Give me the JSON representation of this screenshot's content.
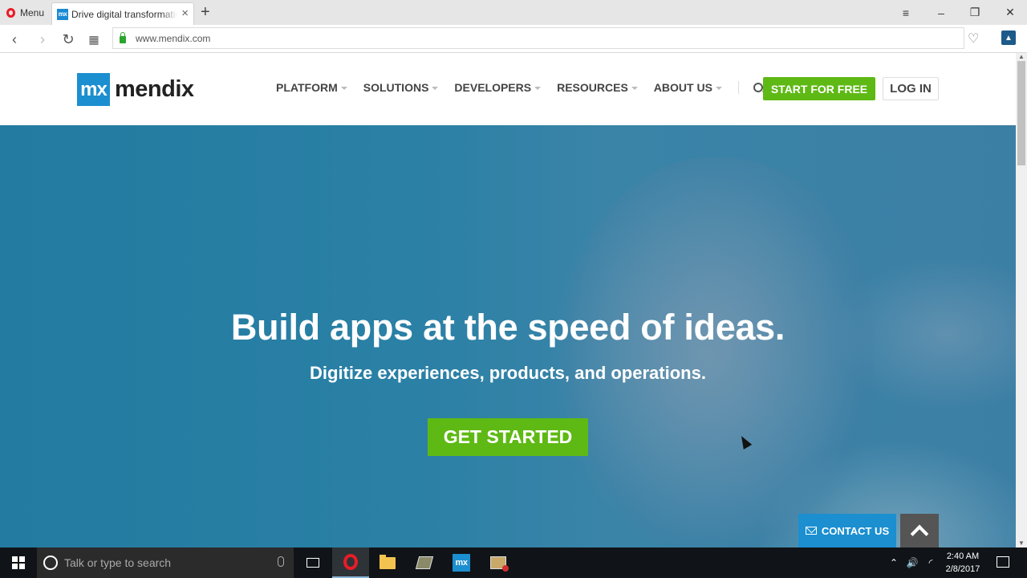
{
  "browser": {
    "menu_label": "Menu",
    "tab_title": "Drive digital transformation",
    "tab_favicon": "mx",
    "url": "www.mendix.com"
  },
  "site": {
    "logo_mark": "mx",
    "logo_text": "mendix",
    "nav": [
      {
        "label": "PLATFORM"
      },
      {
        "label": "SOLUTIONS"
      },
      {
        "label": "DEVELOPERS"
      },
      {
        "label": "RESOURCES"
      },
      {
        "label": "ABOUT US"
      }
    ],
    "start_button": "START FOR FREE",
    "login_button": "LOG IN",
    "accent_color": "#5eb914",
    "brand_color": "#1b8fd0"
  },
  "hero": {
    "title": "Build apps at the speed of ideas.",
    "subtitle": "Digitize experiences, products, and operations.",
    "cta": "GET STARTED",
    "contact": "CONTACT US"
  },
  "taskbar": {
    "search_placeholder": "Talk or type to search",
    "mendix_icon_label": "mx",
    "time": "2:40 AM",
    "date": "2/8/2017"
  }
}
